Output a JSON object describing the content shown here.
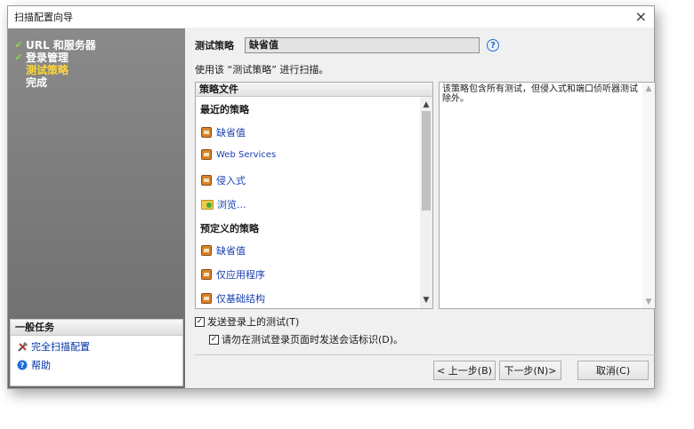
{
  "window": {
    "title": "扫描配置向导",
    "close_glyph": "×"
  },
  "wizard_steps": [
    {
      "label": "URL 和服务器",
      "done": true
    },
    {
      "label": "登录管理",
      "done": true
    },
    {
      "label": "测试策略",
      "current": true
    },
    {
      "label": "完成"
    }
  ],
  "tasks": {
    "header": "一般任务",
    "items": [
      {
        "label": "完全扫描配置",
        "icon": "tools-icon"
      },
      {
        "label": "帮助",
        "icon": "help-icon"
      }
    ]
  },
  "policy": {
    "label": "测试策略",
    "value": "缺省值",
    "help_glyph": "?",
    "usage_text": "使用该 “测试策略” 进行扫描。"
  },
  "policy_files": {
    "header": "策略文件",
    "recent_label": "最近的策略",
    "recent_items": [
      "缺省值",
      "Web Services",
      "侵入式",
      "浏览..."
    ],
    "predefined_label": "预定义的策略",
    "predefined_items": [
      "缺省值",
      "仅应用程序",
      "仅基础结构"
    ]
  },
  "description": {
    "text": "该策略包含所有测试，但侵入式和端口侦听器测试除外。"
  },
  "options": {
    "send_login_tests": {
      "label": "发送登录上的测试(T)",
      "checked": true
    },
    "no_session_ids": {
      "label": "请勿在测试登录页面时发送会话标识(D)。",
      "checked": true
    }
  },
  "buttons": {
    "back": "< 上一步(B)",
    "next": "下一步(N)>",
    "cancel": "取消(C)"
  },
  "colors": {
    "sidebar": "#7a7a7a",
    "current_step": "#ffd83a",
    "done_check": "#8fd14f",
    "link": "#1a3fb0"
  }
}
